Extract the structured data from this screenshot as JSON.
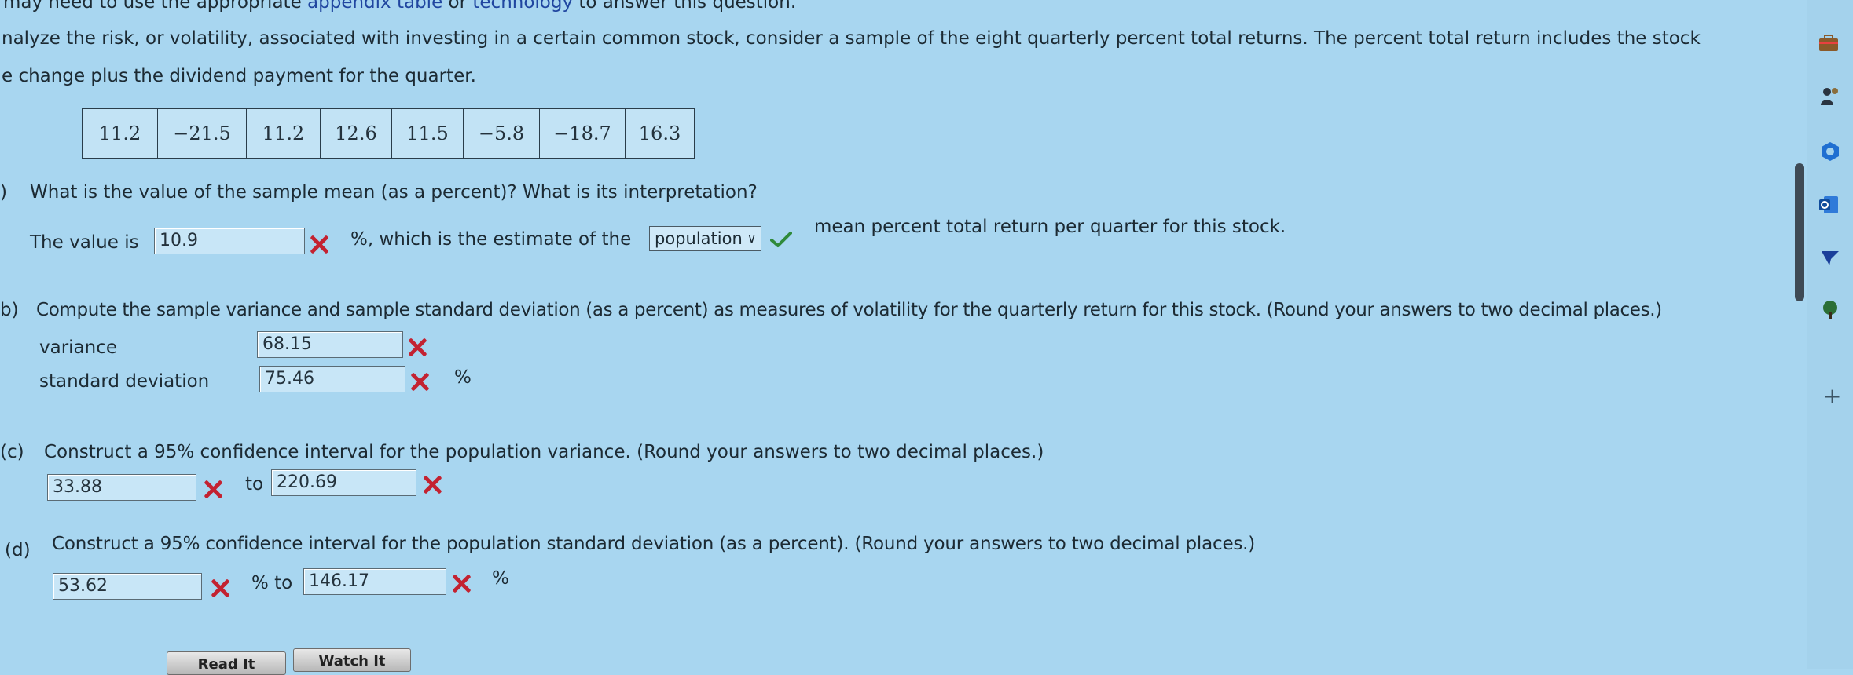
{
  "intro": {
    "line0_prefix": "may need to use the appropriate ",
    "line0_link": "appendix table",
    "line0_mid": " or ",
    "line0_link2": "technology",
    "line0_suffix": " to answer this question.",
    "line1": "nalyze the risk, or volatility, associated with investing in a certain common stock, consider a sample of the eight quarterly percent total returns. The percent total return includes the stock",
    "line2": "e change plus the dividend payment for the quarter."
  },
  "data_values": [
    "11.2",
    "−21.5",
    "11.2",
    "12.6",
    "11.5",
    "−5.8",
    "−18.7",
    "16.3"
  ],
  "part_a": {
    "marker": ")",
    "question": "What is the value of the sample mean (as a percent)? What is its interpretation?",
    "prefix": "The value is",
    "value": "10.9",
    "after_value": "%, which is the estimate of the",
    "select_value": "population",
    "suffix": "mean percent total return per quarter for this stock."
  },
  "part_b": {
    "marker": "b)",
    "question": "Compute the sample variance and sample standard deviation (as a percent) as measures of volatility for the quarterly return for this stock. (Round your answers to two decimal places.)",
    "variance_label": "variance",
    "variance_value": "68.15",
    "sd_label": "standard deviation",
    "sd_value": "75.46",
    "sd_unit": "%"
  },
  "part_c": {
    "marker": "(c)",
    "question": "Construct a 95% confidence interval for the population variance. (Round your answers to two decimal places.)",
    "lower": "33.88",
    "to": "to",
    "upper": "220.69"
  },
  "part_d": {
    "marker": "(d)",
    "question": "Construct a 95% confidence interval for the population standard deviation (as a percent). (Round your answers to two decimal places.)",
    "lower": "53.62",
    "to": "% to",
    "upper": "146.17",
    "unit": "%"
  },
  "buttons": {
    "read_it": "Read It",
    "watch_it": "Watch It"
  },
  "colors": {
    "background": "#a8d6f0",
    "incorrect": "#c32231",
    "correct": "#2f8a3a",
    "link": "#2046a0"
  },
  "sidebar": {
    "icons": [
      "briefcase-icon",
      "people-icon",
      "circle-icon",
      "outlook-icon",
      "arrow-icon",
      "tree-icon"
    ],
    "add_label": "+"
  }
}
